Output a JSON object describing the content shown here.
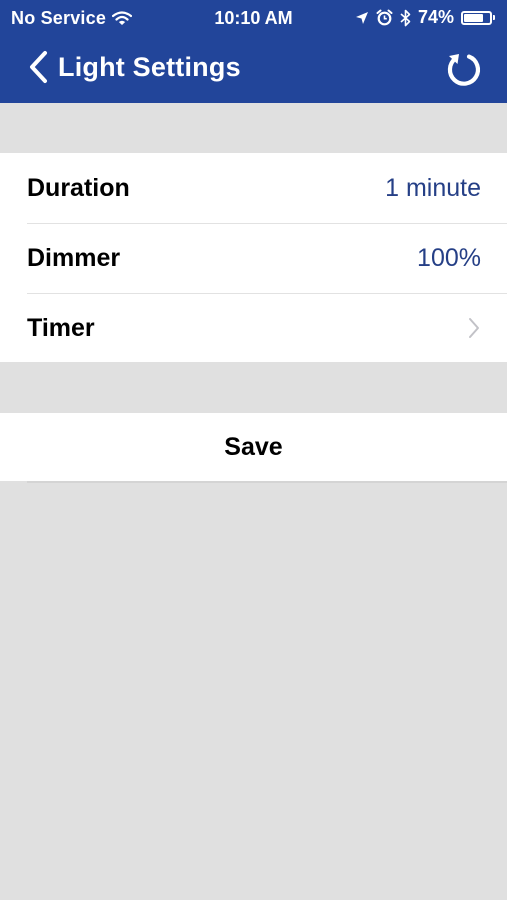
{
  "status_bar": {
    "carrier": "No Service",
    "time": "10:10 AM",
    "battery": "74%",
    "battery_level": 0.74
  },
  "nav": {
    "title": "Light Settings",
    "back_icon": "chevron-left-icon",
    "refresh_icon": "refresh-icon"
  },
  "settings": {
    "rows": [
      {
        "label": "Duration",
        "value": "1 minute"
      },
      {
        "label": "Dimmer",
        "value": "100%"
      },
      {
        "label": "Timer",
        "value": ""
      }
    ]
  },
  "actions": {
    "save_label": "Save"
  },
  "colors": {
    "header": "#22459a",
    "value_text": "#253f86",
    "background": "#e0e0e0"
  }
}
